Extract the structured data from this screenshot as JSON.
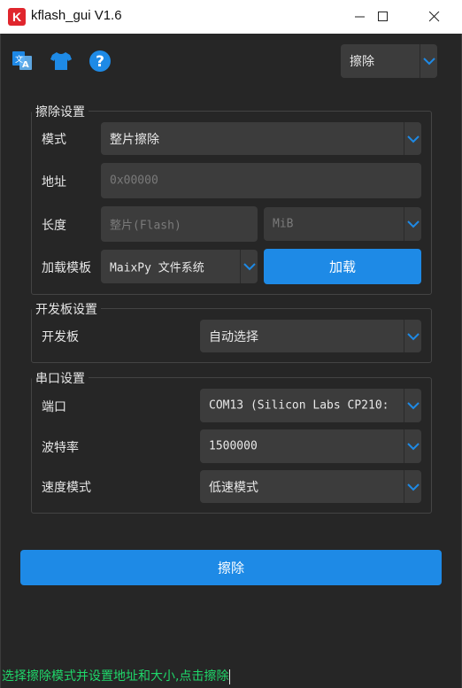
{
  "window": {
    "title": "kflash_gui V1.6",
    "logo_letter": "K",
    "accent_color": "#1e8ae6",
    "logo_color": "#e0262d"
  },
  "toolbar": {
    "icons": [
      "language-icon",
      "skin-icon",
      "help-icon"
    ],
    "mode_select": "擦除"
  },
  "erase_settings": {
    "title": "擦除设置",
    "mode_label": "模式",
    "mode_value": "整片擦除",
    "address_label": "地址",
    "address_placeholder": "0x00000",
    "length_label": "长度",
    "length_placeholder": "整片(Flash)",
    "length_unit": "MiB",
    "template_label": "加载模板",
    "template_value": "MaixPy 文件系统",
    "load_button": "加载"
  },
  "board_settings": {
    "title": "开发板设置",
    "board_label": "开发板",
    "board_value": "自动选择"
  },
  "serial_settings": {
    "title": "串口设置",
    "port_label": "端口",
    "port_value": "COM13 (Silicon Labs CP210:",
    "baud_label": "波特率",
    "baud_value": "1500000",
    "speed_label": "速度模式",
    "speed_value": "低速模式"
  },
  "action_button": "擦除",
  "status_text": "选择擦除模式并设置地址和大小,点击擦除"
}
